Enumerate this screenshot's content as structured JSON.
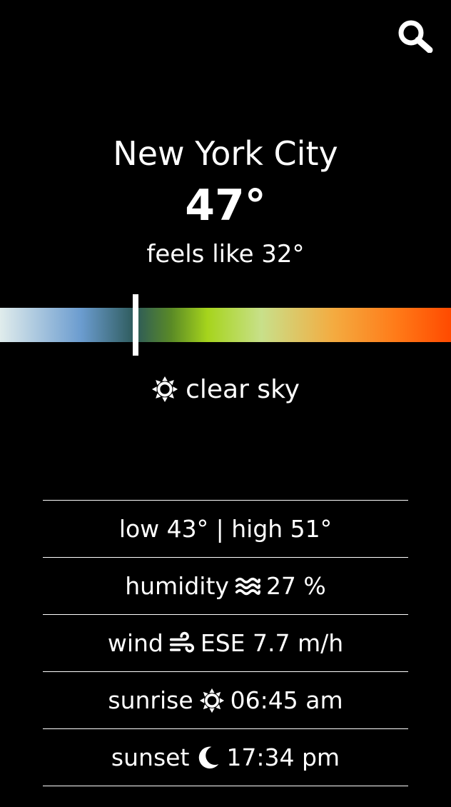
{
  "location": {
    "city": "New York City"
  },
  "current": {
    "temperature": "47°",
    "feels_like": "feels like 32°",
    "condition": "clear sky",
    "condition_icon": "sun-icon"
  },
  "temperature_scale": {
    "marker_fraction": 0.3
  },
  "details": {
    "low_high": "low 43° | high 51°",
    "humidity_label": "humidity",
    "humidity_icon": "water-waves-icon",
    "humidity_value": "27 %",
    "wind_label": "wind",
    "wind_icon": "wind-icon",
    "wind_value": "ESE 7.7 m/h",
    "sunrise_label": "sunrise",
    "sunrise_icon": "sun-gear-icon",
    "sunrise_value": "06:45 am",
    "sunset_label": "sunset",
    "sunset_icon": "moon-icon",
    "sunset_value": "17:34 pm"
  },
  "header": {
    "search_icon": "search-icon"
  },
  "colors": {
    "background": "#000000",
    "text": "#ffffff",
    "scale_cold": "#e0ecec",
    "scale_cool": "#6b9ccf",
    "scale_mild": "#a6d41c",
    "scale_warm": "#f4ab40",
    "scale_hot": "#ff4a00"
  }
}
